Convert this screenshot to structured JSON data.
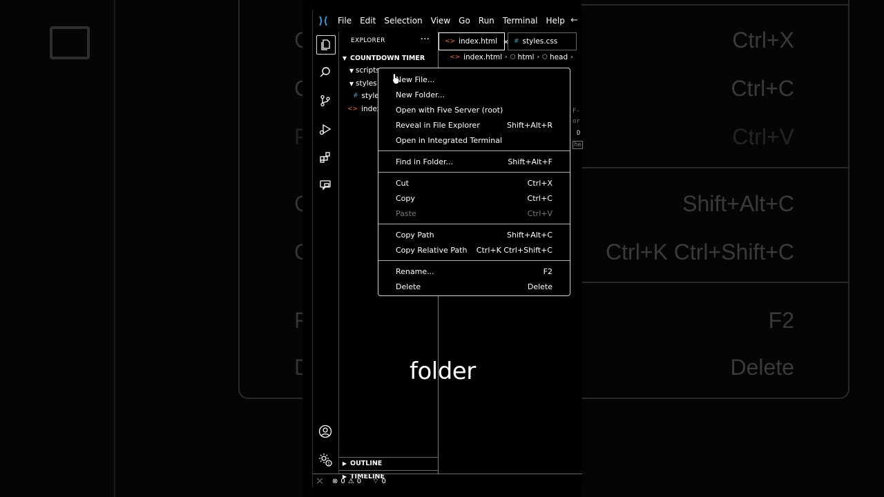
{
  "background": {
    "left_letters": [
      "C",
      "C",
      "P",
      "C",
      "C",
      "F",
      "D"
    ],
    "right_shortcuts": [
      "Ctrl+X",
      "Ctrl+C",
      "Ctrl+V",
      "Shift+Alt+C",
      "Ctrl+K Ctrl+Shift+C",
      "F2",
      "Delete"
    ]
  },
  "titlebar": {
    "logo": "⟩⟨",
    "menu": [
      "File",
      "Edit",
      "Selection",
      "View",
      "Go",
      "Run",
      "Terminal",
      "Help"
    ],
    "back": "←"
  },
  "sidebar": {
    "header": "EXPLORER",
    "more": "···",
    "project": "COUNTDOWN TIMER",
    "tree": {
      "scripts": "scripts",
      "styles": "styles",
      "styles_file": "style",
      "index_file": "index."
    },
    "outline": "OUTLINE",
    "timeline": "TIMELINE"
  },
  "editor": {
    "tabs": [
      {
        "label": "index.html",
        "close": "×"
      },
      {
        "label": "styles.css"
      }
    ],
    "breadcrumbs": [
      "index.html",
      "html",
      "head"
    ]
  },
  "statusbar": {
    "errors": "0",
    "warnings": "0",
    "ports": "0"
  },
  "context_menu": {
    "groups": [
      [
        {
          "label": "New File...",
          "shortcut": ""
        },
        {
          "label": "New Folder...",
          "shortcut": ""
        },
        {
          "label": "Open with Five Server (root)",
          "shortcut": ""
        },
        {
          "label": "Reveal in File Explorer",
          "shortcut": "Shift+Alt+R"
        },
        {
          "label": "Open in Integrated Terminal",
          "shortcut": ""
        }
      ],
      [
        {
          "label": "Find in Folder...",
          "shortcut": "Shift+Alt+F"
        }
      ],
      [
        {
          "label": "Cut",
          "shortcut": "Ctrl+X"
        },
        {
          "label": "Copy",
          "shortcut": "Ctrl+C"
        },
        {
          "label": "Paste",
          "shortcut": "Ctrl+V",
          "disabled": true
        }
      ],
      [
        {
          "label": "Copy Path",
          "shortcut": "Shift+Alt+C"
        },
        {
          "label": "Copy Relative Path",
          "shortcut": "Ctrl+K Ctrl+Shift+C"
        }
      ],
      [
        {
          "label": "Rename...",
          "shortcut": "F2"
        },
        {
          "label": "Delete",
          "shortcut": "Delete"
        }
      ]
    ]
  },
  "caption": "folder",
  "colors": {
    "background": "#000000",
    "html_icon": "#e37933",
    "css_icon": "#519aba",
    "vscode_logo": "#3d9be9",
    "disabled_text": "#7a7a7a"
  }
}
